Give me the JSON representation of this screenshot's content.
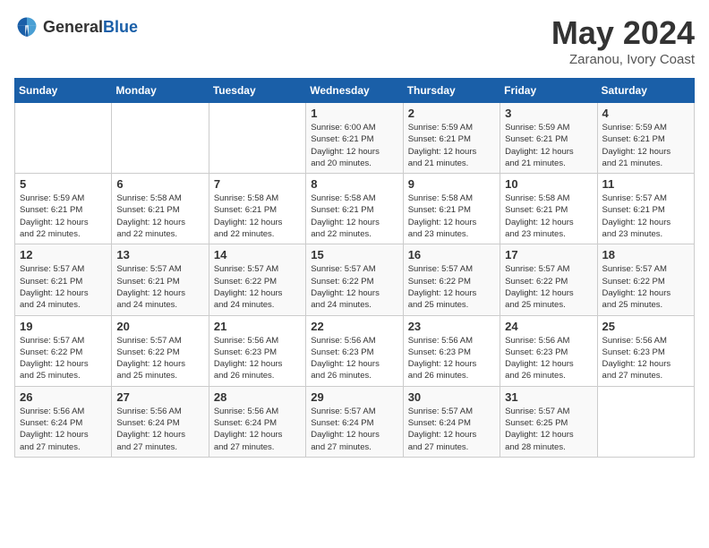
{
  "header": {
    "logo_general": "General",
    "logo_blue": "Blue",
    "month_year": "May 2024",
    "location": "Zaranou, Ivory Coast"
  },
  "weekdays": [
    "Sunday",
    "Monday",
    "Tuesday",
    "Wednesday",
    "Thursday",
    "Friday",
    "Saturday"
  ],
  "weeks": [
    [
      {
        "day": "",
        "detail": ""
      },
      {
        "day": "",
        "detail": ""
      },
      {
        "day": "",
        "detail": ""
      },
      {
        "day": "1",
        "detail": "Sunrise: 6:00 AM\nSunset: 6:21 PM\nDaylight: 12 hours\nand 20 minutes."
      },
      {
        "day": "2",
        "detail": "Sunrise: 5:59 AM\nSunset: 6:21 PM\nDaylight: 12 hours\nand 21 minutes."
      },
      {
        "day": "3",
        "detail": "Sunrise: 5:59 AM\nSunset: 6:21 PM\nDaylight: 12 hours\nand 21 minutes."
      },
      {
        "day": "4",
        "detail": "Sunrise: 5:59 AM\nSunset: 6:21 PM\nDaylight: 12 hours\nand 21 minutes."
      }
    ],
    [
      {
        "day": "5",
        "detail": "Sunrise: 5:59 AM\nSunset: 6:21 PM\nDaylight: 12 hours\nand 22 minutes."
      },
      {
        "day": "6",
        "detail": "Sunrise: 5:58 AM\nSunset: 6:21 PM\nDaylight: 12 hours\nand 22 minutes."
      },
      {
        "day": "7",
        "detail": "Sunrise: 5:58 AM\nSunset: 6:21 PM\nDaylight: 12 hours\nand 22 minutes."
      },
      {
        "day": "8",
        "detail": "Sunrise: 5:58 AM\nSunset: 6:21 PM\nDaylight: 12 hours\nand 22 minutes."
      },
      {
        "day": "9",
        "detail": "Sunrise: 5:58 AM\nSunset: 6:21 PM\nDaylight: 12 hours\nand 23 minutes."
      },
      {
        "day": "10",
        "detail": "Sunrise: 5:58 AM\nSunset: 6:21 PM\nDaylight: 12 hours\nand 23 minutes."
      },
      {
        "day": "11",
        "detail": "Sunrise: 5:57 AM\nSunset: 6:21 PM\nDaylight: 12 hours\nand 23 minutes."
      }
    ],
    [
      {
        "day": "12",
        "detail": "Sunrise: 5:57 AM\nSunset: 6:21 PM\nDaylight: 12 hours\nand 24 minutes."
      },
      {
        "day": "13",
        "detail": "Sunrise: 5:57 AM\nSunset: 6:21 PM\nDaylight: 12 hours\nand 24 minutes."
      },
      {
        "day": "14",
        "detail": "Sunrise: 5:57 AM\nSunset: 6:22 PM\nDaylight: 12 hours\nand 24 minutes."
      },
      {
        "day": "15",
        "detail": "Sunrise: 5:57 AM\nSunset: 6:22 PM\nDaylight: 12 hours\nand 24 minutes."
      },
      {
        "day": "16",
        "detail": "Sunrise: 5:57 AM\nSunset: 6:22 PM\nDaylight: 12 hours\nand 25 minutes."
      },
      {
        "day": "17",
        "detail": "Sunrise: 5:57 AM\nSunset: 6:22 PM\nDaylight: 12 hours\nand 25 minutes."
      },
      {
        "day": "18",
        "detail": "Sunrise: 5:57 AM\nSunset: 6:22 PM\nDaylight: 12 hours\nand 25 minutes."
      }
    ],
    [
      {
        "day": "19",
        "detail": "Sunrise: 5:57 AM\nSunset: 6:22 PM\nDaylight: 12 hours\nand 25 minutes."
      },
      {
        "day": "20",
        "detail": "Sunrise: 5:57 AM\nSunset: 6:22 PM\nDaylight: 12 hours\nand 25 minutes."
      },
      {
        "day": "21",
        "detail": "Sunrise: 5:56 AM\nSunset: 6:23 PM\nDaylight: 12 hours\nand 26 minutes."
      },
      {
        "day": "22",
        "detail": "Sunrise: 5:56 AM\nSunset: 6:23 PM\nDaylight: 12 hours\nand 26 minutes."
      },
      {
        "day": "23",
        "detail": "Sunrise: 5:56 AM\nSunset: 6:23 PM\nDaylight: 12 hours\nand 26 minutes."
      },
      {
        "day": "24",
        "detail": "Sunrise: 5:56 AM\nSunset: 6:23 PM\nDaylight: 12 hours\nand 26 minutes."
      },
      {
        "day": "25",
        "detail": "Sunrise: 5:56 AM\nSunset: 6:23 PM\nDaylight: 12 hours\nand 27 minutes."
      }
    ],
    [
      {
        "day": "26",
        "detail": "Sunrise: 5:56 AM\nSunset: 6:24 PM\nDaylight: 12 hours\nand 27 minutes."
      },
      {
        "day": "27",
        "detail": "Sunrise: 5:56 AM\nSunset: 6:24 PM\nDaylight: 12 hours\nand 27 minutes."
      },
      {
        "day": "28",
        "detail": "Sunrise: 5:56 AM\nSunset: 6:24 PM\nDaylight: 12 hours\nand 27 minutes."
      },
      {
        "day": "29",
        "detail": "Sunrise: 5:57 AM\nSunset: 6:24 PM\nDaylight: 12 hours\nand 27 minutes."
      },
      {
        "day": "30",
        "detail": "Sunrise: 5:57 AM\nSunset: 6:24 PM\nDaylight: 12 hours\nand 27 minutes."
      },
      {
        "day": "31",
        "detail": "Sunrise: 5:57 AM\nSunset: 6:25 PM\nDaylight: 12 hours\nand 28 minutes."
      },
      {
        "day": "",
        "detail": ""
      }
    ]
  ]
}
